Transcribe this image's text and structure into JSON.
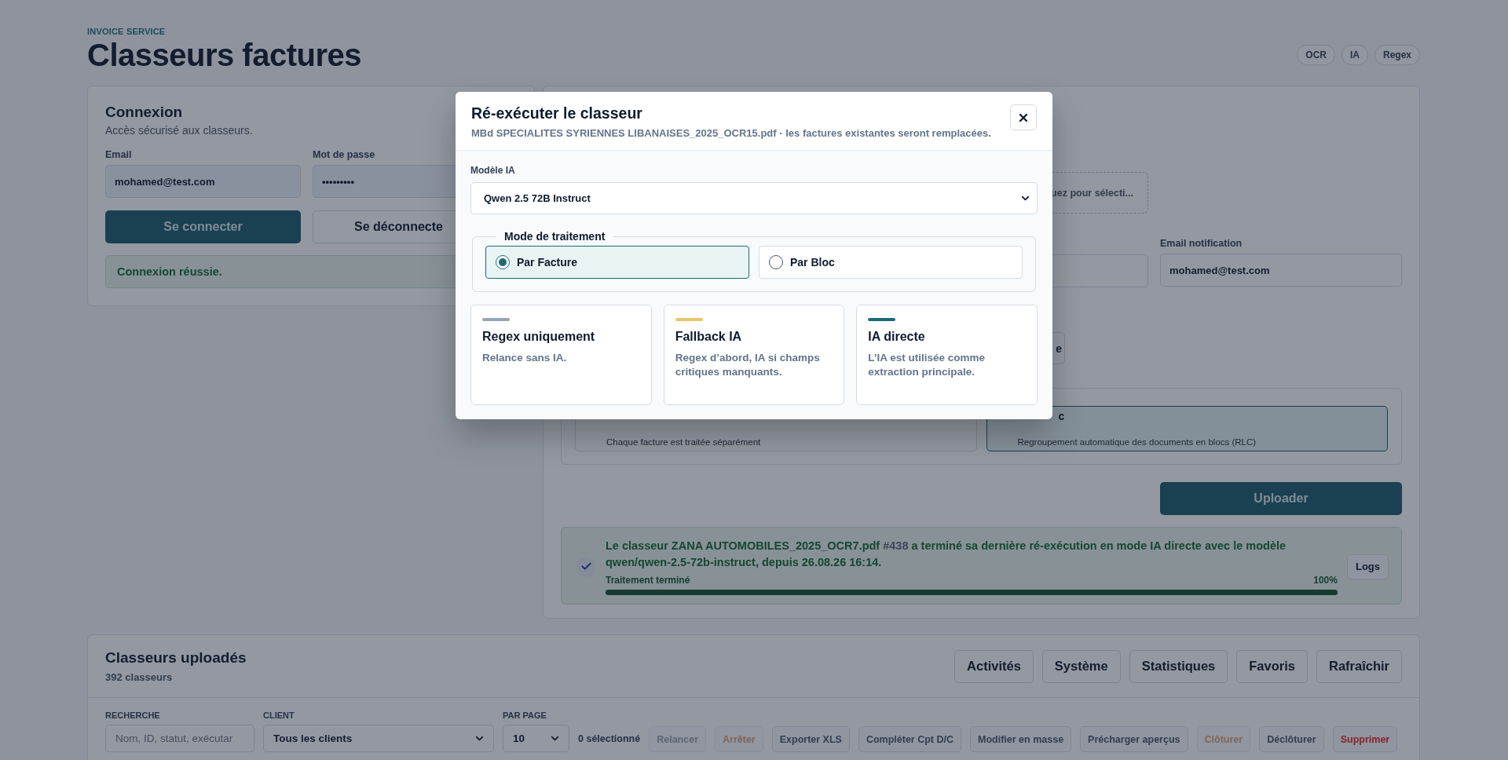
{
  "header": {
    "eyebrow": "INVOICE SERVICE",
    "title": "Classeurs factures",
    "chips": [
      "OCR",
      "IA",
      "Regex"
    ]
  },
  "login": {
    "title": "Connexion",
    "subtitle": "Accès sécurisé aux classeurs.",
    "email_label": "Email",
    "email_value": "mohamed@test.com",
    "password_label": "Mot de passe",
    "password_value": "•••••••••",
    "login_button": "Se connecter",
    "logout_button": "Se déconnecte",
    "message": "Connexion réussie."
  },
  "upload": {
    "dropzone_text": "uez pour sélecti...",
    "email_label": "Email notification",
    "email_value": "mohamed@test.com",
    "button_fragment": "e",
    "mode_options": [
      {
        "description": "Chaque facture est traitée séparément",
        "selected": false
      },
      {
        "title": "c",
        "description": "Regroupement automatique des documents en blocs (RLC)",
        "selected": true
      }
    ],
    "upload_button": "Uploader",
    "status": {
      "prefix": "Le classeur ZANA AUTOMOBILES_2025_OCR7.pdf",
      "id": "#438",
      "suffix": "a terminé sa dernière ré-exécution en mode IA directe avec le modèle qwen/qwen-2.5-72b-instruct, depuis 26.08.26 16:14.",
      "progress_label": "Traitement terminé",
      "progress_value": "100%",
      "level": 1,
      "logs_button": "Logs"
    }
  },
  "list": {
    "title": "Classeurs uploadés",
    "count": "392 classeurs",
    "actions": [
      "Activités",
      "Système",
      "Statistiques",
      "Favoris",
      "Rafraîchir"
    ],
    "search_label": "RECHERCHE",
    "search_placeholder": "Nom, ID, statut, exécutar",
    "client_label": "CLIENT",
    "client_value": "Tous les clients",
    "per_page_label": "PAR PAGE",
    "per_page_value": "10",
    "selection": "0 sélectionné",
    "bulk_actions": [
      {
        "label": "Relancer",
        "kind": "neutral",
        "disabled": true
      },
      {
        "label": "Arrêter",
        "kind": "warning",
        "disabled": true
      },
      {
        "label": "Exporter XLS",
        "kind": "neutral",
        "disabled": false
      },
      {
        "label": "Compléter Cpt D/C",
        "kind": "neutral",
        "disabled": false
      },
      {
        "label": "Modifier en masse",
        "kind": "neutral",
        "disabled": false
      },
      {
        "label": "Précharger aperçus",
        "kind": "neutral",
        "disabled": false
      },
      {
        "label": "Clôturer",
        "kind": "warning",
        "disabled": true
      },
      {
        "label": "Déclôturer",
        "kind": "neutral",
        "disabled": false
      },
      {
        "label": "Supprimer",
        "kind": "danger",
        "disabled": false
      }
    ]
  },
  "modal": {
    "title": "Ré-exécuter le classeur",
    "subtitle": "MBd SPECIALITES SYRIENNES LIBANAISES_2025_OCR15.pdf · les factures existantes seront remplacées.",
    "model_label": "Modèle IA",
    "model_value": "Qwen 2.5 72B Instruct",
    "mode_legend": "Mode de traitement",
    "modes": [
      {
        "label": "Par Facture",
        "selected": true
      },
      {
        "label": "Par Bloc",
        "selected": false
      }
    ],
    "strategies": [
      {
        "title": "Regex uniquement",
        "description": "Relance sans IA.",
        "color": "#94a3b8"
      },
      {
        "title": "Fallback IA",
        "description": "Regex d’abord, IA si champs critiques manquants.",
        "color": "#e9c46a"
      },
      {
        "title": "IA directe",
        "description": "L’IA est utilisée comme extraction principale.",
        "color": "#1b6b73"
      }
    ]
  }
}
